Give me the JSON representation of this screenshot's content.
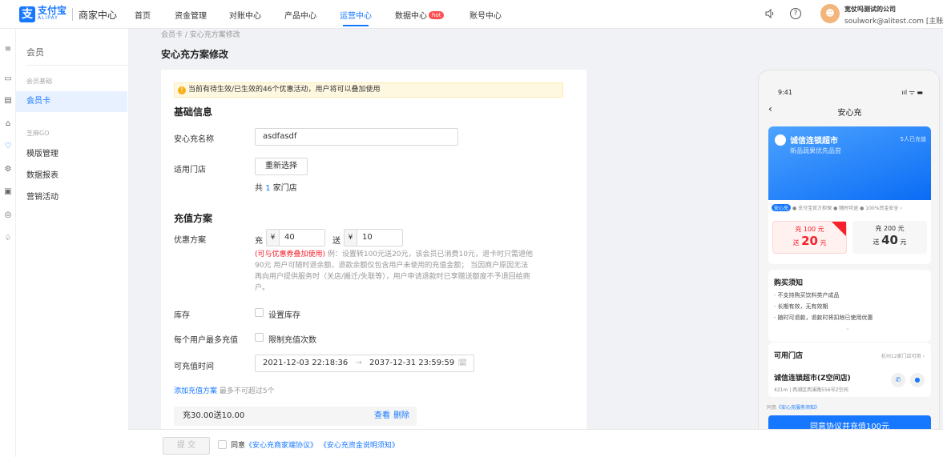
{
  "brand": {
    "logo_glyph": "支",
    "name_cn": "支付宝",
    "name_en": "ALIPAY",
    "product": "商家中心"
  },
  "nav": {
    "items": [
      "首页",
      "资金管理",
      "对账中心",
      "产品中心",
      "运营中心",
      "数据中心",
      "账号中心"
    ],
    "active": "运营中心",
    "hot_badge": "hot",
    "accent": "#1677ff"
  },
  "user": {
    "avatar_glyph": "☻",
    "company": "宽仗吗测试的公司",
    "email": "soulwork@alitest.com [主账号]"
  },
  "rail_icons": [
    "menu-icon",
    "monitor-icon",
    "document-icon",
    "shop-icon",
    "member-icon",
    "gear-icon",
    "card-icon",
    "target-icon",
    "bell-icon"
  ],
  "sidebar": {
    "title": "会员",
    "group1": "会员基础",
    "group1_items": [
      "会员卡"
    ],
    "group2": "芝麻GO",
    "group2_items": [
      "模版管理",
      "数据报表",
      "营销活动"
    ]
  },
  "breadcrumb": "会员卡 / 安心充方案修改",
  "page_title": "安心充方案修改",
  "form": {
    "notice_icon": "!",
    "notice": "当前有待生效/已生效的46个优惠活动，用户将可以叠加使用",
    "basic_title": "基础信息",
    "name_label": "安心充名称",
    "name_value": "asdfasdf",
    "store_label": "适用门店",
    "store_button": "重新选择",
    "store_count_prefix": "共",
    "store_count": "1",
    "store_count_suffix": "家门店",
    "recharge_title": "充值方案",
    "plan_label": "优惠方案",
    "charge_word": "充",
    "charge_currency": "¥",
    "charge_value": "40",
    "gift_word": "送",
    "gift_currency": "¥",
    "gift_value": "10",
    "hint_red": "(可与优惠券叠加使用)",
    "hint_text": "例：设置转100元送20元，该会员已消费10元，退卡时只需退他90元 用户可随时退余额，退款余额仅包含用户未使用的充值金额； 当因商户原因无法再向用户提供服务时（关店/搬迁/失联等），用户申请退款时已享赠送额度不予退回给商户。",
    "stock_label": "库存",
    "stock_check": "设置库存",
    "limit_label": "每个用户最多充值",
    "limit_check": "限制充值次数",
    "time_label": "可充值时间",
    "time_start": "2021-12-03 22:18:36",
    "time_arrow": "→",
    "time_end": "2037-12-31 23:59:59",
    "time_icon": "🗓",
    "add_link": "添加充值方案",
    "add_note": "最多不可超过5个",
    "plan_row_text": "充30.00送10.00",
    "plan_view": "查看",
    "plan_delete": "删除"
  },
  "phone": {
    "time": "9:41",
    "status_icons": "ııl ᯤ ▬",
    "back": "‹",
    "title": "安心充",
    "shop_name": "诚信连锁超市",
    "shop_sub": "新品蔬果优先品尝",
    "shop_count": "5人已充值",
    "guarantee_tag": "安心充",
    "guarantee_text": "● 支付宝官方担保 ● 随时可退 ● 100%资金安全 ›",
    "option1_line1": "充 100 元",
    "option1_prefix": "送",
    "option1_big": "20",
    "option1_suffix": "元",
    "option2_line1": "充 200 元",
    "option2_prefix": "送",
    "option2_big": "40",
    "option2_suffix": "元",
    "rules_title": "购买须知",
    "rules": [
      "· 不支持购买饮料类产成品",
      "· 长期有效，无有效期",
      "· 随时可退款，退款时将扣除已使用优惠"
    ],
    "rules_more": "⌄",
    "stores_title": "可用门店",
    "stores_link": "杭州12家门店可用 ›",
    "store_name": "诚信连锁超市(Z空间店)",
    "store_addr": "421m | 西湖区西溪路556号Z空间",
    "agree_prefix": "同意",
    "agree_link": "《安心充服务须知》",
    "cta": "同意协议并充值100元"
  },
  "footer": {
    "submit": "提 交",
    "agree_prefix": "同意",
    "agreement1": "《安心充商家端协议》",
    "agreement2": "《安心充资金说明须知》"
  }
}
